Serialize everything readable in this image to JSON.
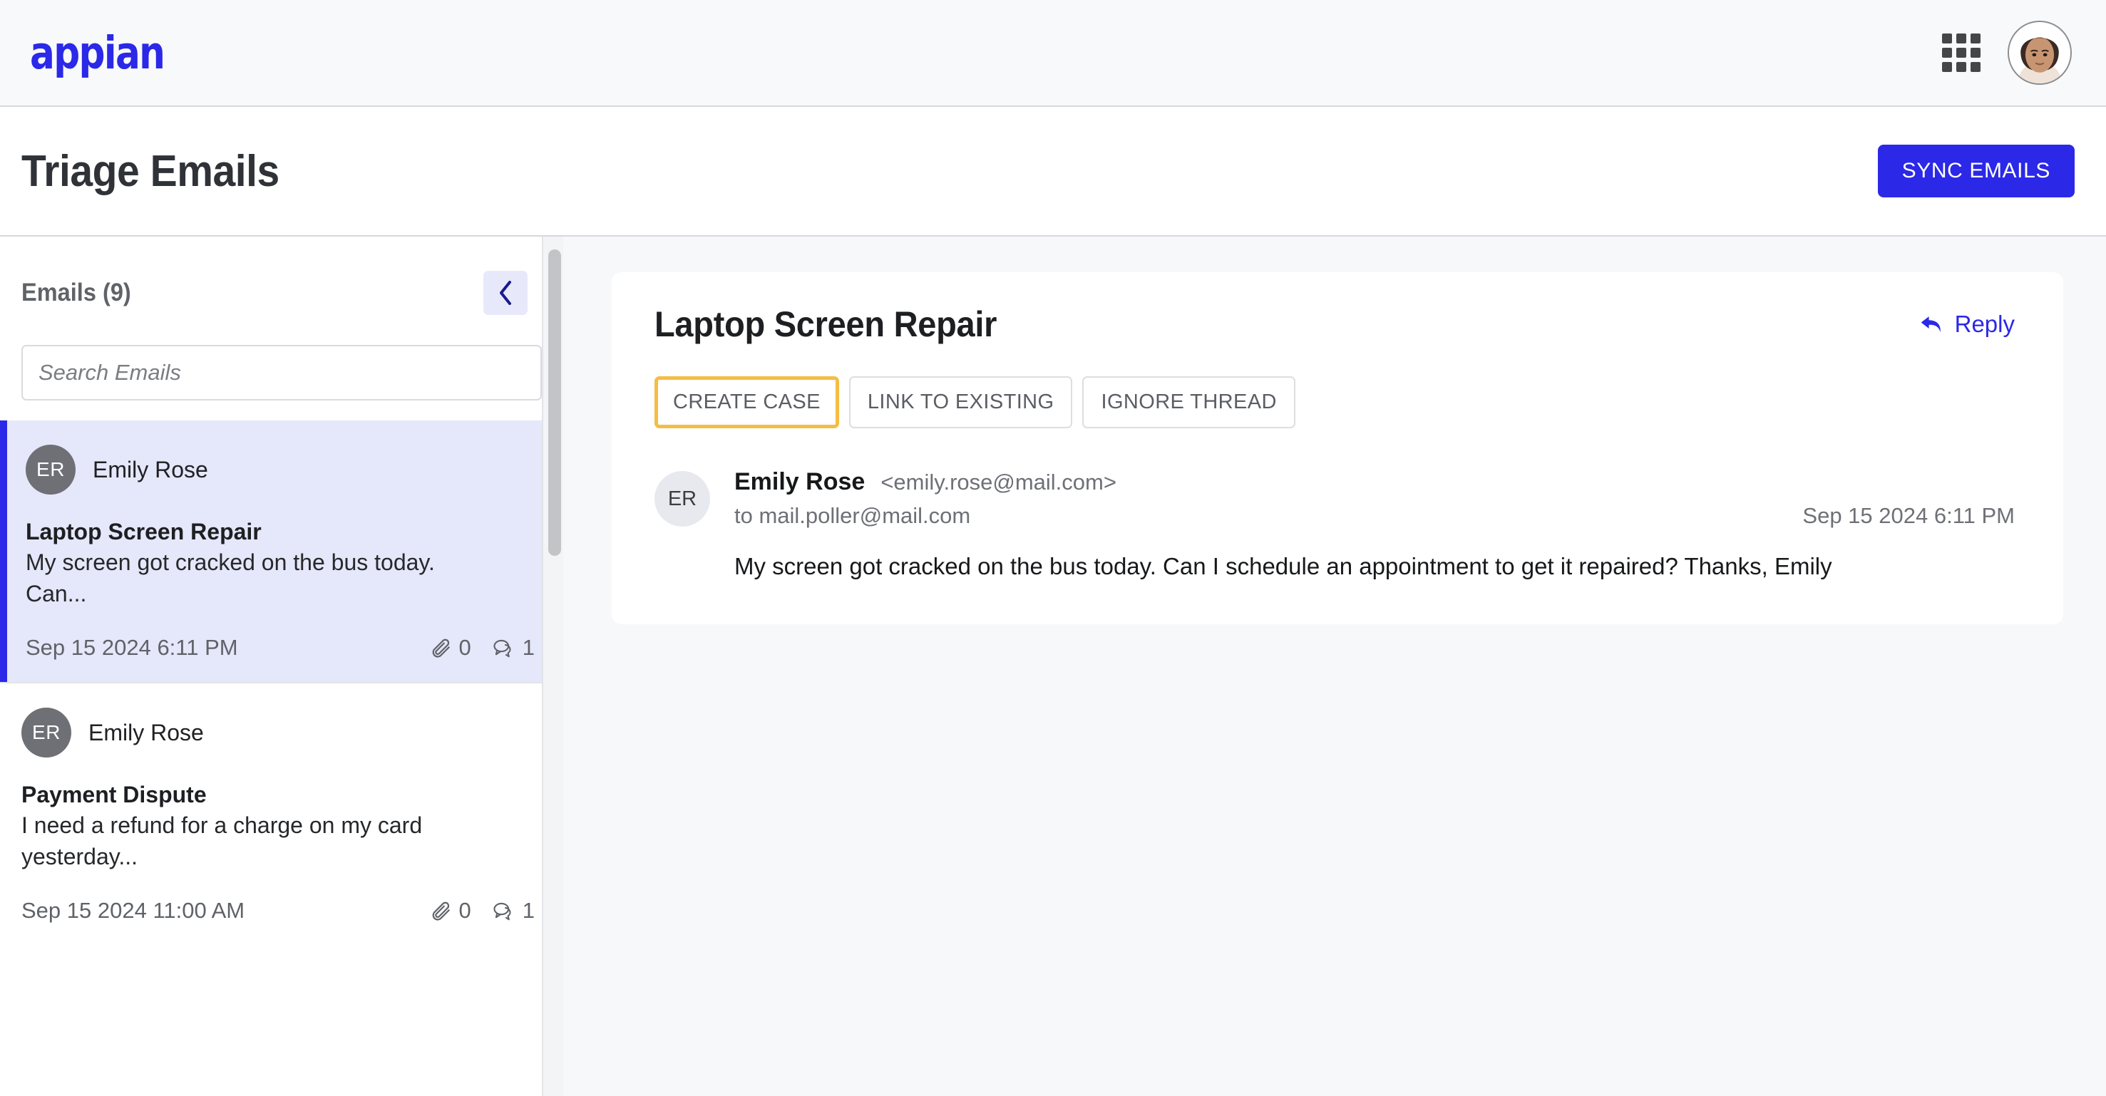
{
  "topbar": {
    "brand": "appian",
    "apps_icon": "grid-apps-icon",
    "avatar_icon": "user-avatar-photo"
  },
  "titlebar": {
    "title": "Triage Emails",
    "sync_label": "SYNC EMAILS"
  },
  "sidebar": {
    "header": "Emails (9)",
    "collapse_icon": "chevron-left-icon",
    "search_placeholder": "Search Emails",
    "search_value": "",
    "emails": [
      {
        "initials": "ER",
        "sender": "Emily Rose",
        "subject": "Laptop Screen Repair",
        "preview": "My screen got cracked on the bus today. Can...",
        "date": "Sep 15 2024 6:11 PM",
        "attachments": "0",
        "comments": "1",
        "selected": true
      },
      {
        "initials": "ER",
        "sender": "Emily Rose",
        "subject": "Payment Dispute",
        "preview": "I need a refund for a charge on my card yesterday...",
        "date": "Sep 15 2024 11:00 AM",
        "attachments": "0",
        "comments": "1",
        "selected": false
      }
    ]
  },
  "detail": {
    "subject": "Laptop Screen Repair",
    "reply_label": "Reply",
    "reply_icon": "reply-arrow-icon",
    "actions": [
      {
        "label": "CREATE CASE",
        "focused": true
      },
      {
        "label": "LINK TO EXISTING",
        "focused": false
      },
      {
        "label": "IGNORE THREAD",
        "focused": false
      }
    ],
    "message": {
      "initials": "ER",
      "from_name": "Emily Rose",
      "from_email": "<emily.rose@mail.com>",
      "to": "to mail.poller@mail.com",
      "date": "Sep 15 2024 6:11 PM",
      "text": "My screen got cracked on the bus today. Can I schedule an appointment to get it repaired?  Thanks, Emily"
    }
  },
  "colors": {
    "brand_blue": "#2B28E8",
    "focus_yellow": "#f5bd45",
    "selected_bg": "#e5e7fa",
    "page_bg": "#f7f8fa"
  }
}
